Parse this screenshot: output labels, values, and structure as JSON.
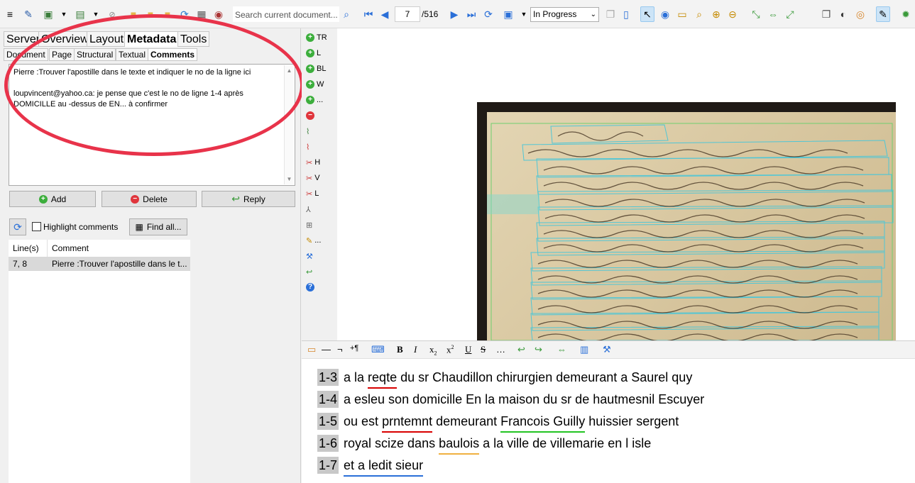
{
  "toolbar": {
    "search_placeholder": "Search current document...",
    "page_current": "7",
    "page_total": "/516",
    "status": "In Progress"
  },
  "left_panel": {
    "tabs": [
      "Server",
      "Overview",
      "Layout",
      "Metadata",
      "Tools"
    ],
    "selected_tab": "Metadata",
    "subtabs": [
      "Document",
      "Page",
      "Structural",
      "Textual",
      "Comments"
    ],
    "selected_subtab": "Comments",
    "comment_text": [
      "Pierre :Trouver l'apostille dans le texte et indiquer le no de la ligne ici",
      "",
      "loupvincent@yahoo.ca: je pense que c'est le no de ligne 1-4 après",
      "DOMICILLE au -dessus de EN... à confirmer"
    ],
    "buttons": {
      "add": "Add",
      "delete": "Delete",
      "reply": "Reply"
    },
    "highlight_label": "Highlight comments",
    "find_all": "Find all...",
    "table": {
      "headers": [
        "Line(s)",
        "Comment"
      ],
      "rows": [
        {
          "lines": "7, 8",
          "comment": "Pierre :Trouver l'apostille dans le t..."
        }
      ]
    }
  },
  "icon_column": {
    "labels": [
      "TR",
      "L",
      "BL",
      "W",
      "...",
      "H",
      "V",
      "L",
      "..."
    ]
  },
  "transcript": {
    "lines": [
      {
        "num": "1-3",
        "parts": [
          {
            "t": "a la "
          },
          {
            "t": "reqte",
            "u": "red"
          },
          {
            "t": " du sr Chaudillon chirurgien demeurant a Saurel quy"
          }
        ]
      },
      {
        "num": "1-4",
        "parts": [
          {
            "t": "a esleu son domicille En la maison du sr de hautmesnil Escuyer"
          }
        ]
      },
      {
        "num": "1-5",
        "parts": [
          {
            "t": "ou est "
          },
          {
            "t": "prntemnt",
            "u": "red"
          },
          {
            "t": " demeurant "
          },
          {
            "t": "Francois Guilly",
            "u": "green"
          },
          {
            "t": " huissier sergent"
          }
        ]
      },
      {
        "num": "1-6",
        "parts": [
          {
            "t": "royal scize dans "
          },
          {
            "t": "baulois",
            "u": "orange"
          },
          {
            "t": " a la ville de villemarie en l isle"
          }
        ]
      },
      {
        "num": "1-7",
        "parts": [
          {
            "t": "et a ledit sieur",
            "u": "blue"
          }
        ]
      }
    ]
  }
}
